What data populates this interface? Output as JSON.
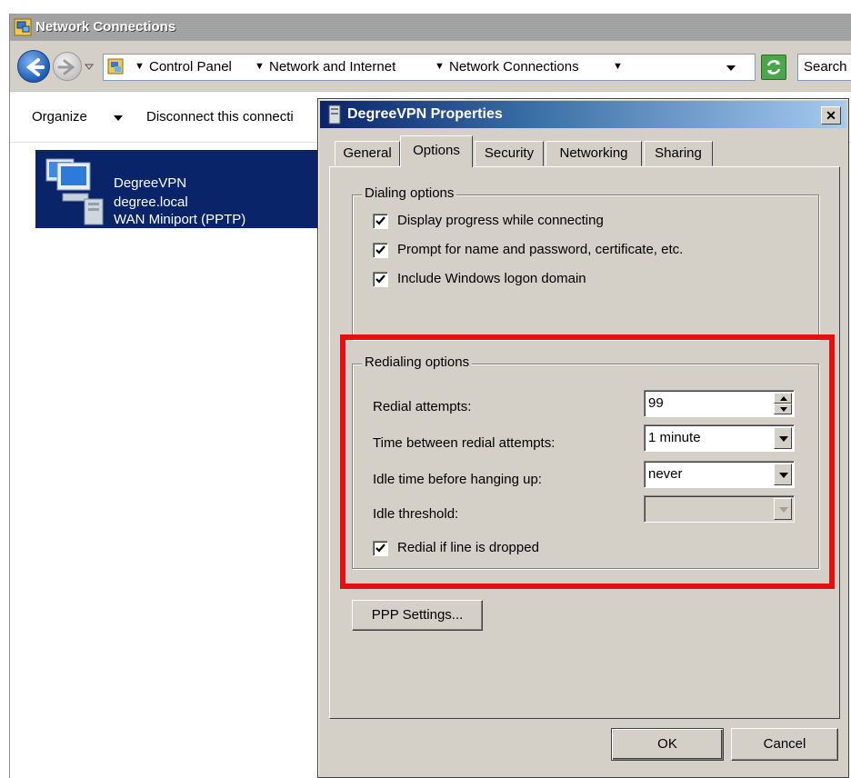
{
  "explorer": {
    "title": "Network Connections",
    "breadcrumb": [
      "Control Panel",
      "Network and Internet",
      "Network Connections"
    ],
    "search_placeholder": "Search",
    "toolbar": {
      "organize": "Organize",
      "disconnect": "Disconnect this connecti"
    },
    "connection": {
      "name": "DegreeVPN",
      "domain": "degree.local",
      "device": "WAN Miniport (PPTP)"
    }
  },
  "dialog": {
    "title": "DegreeVPN Properties",
    "close": "✕",
    "tabs": [
      "General",
      "Options",
      "Security",
      "Networking",
      "Sharing"
    ],
    "active_tab": "Options",
    "dialing": {
      "legend": "Dialing options",
      "options": [
        {
          "label": "Display progress while connecting",
          "checked": true
        },
        {
          "label": "Prompt for name and password, certificate, etc.",
          "checked": true
        },
        {
          "label": "Include Windows logon domain",
          "checked": true
        }
      ]
    },
    "redialing": {
      "legend": "Redialing options",
      "redial_attempts_label": "Redial attempts:",
      "redial_attempts_value": "99",
      "time_between_label": "Time between redial attempts:",
      "time_between_value": "1 minute",
      "idle_time_label": "Idle time before hanging up:",
      "idle_time_value": "never",
      "idle_threshold_label": "Idle threshold:",
      "idle_threshold_value": "",
      "redial_dropped_label": "Redial if line is dropped",
      "redial_dropped_checked": true
    },
    "ppp_button": "PPP Settings...",
    "ok_button": "OK",
    "cancel_button": "Cancel"
  },
  "colors": {
    "highlight": "#e21010",
    "selection": "#0a246a",
    "dialog_face": "#d4d0c8"
  }
}
